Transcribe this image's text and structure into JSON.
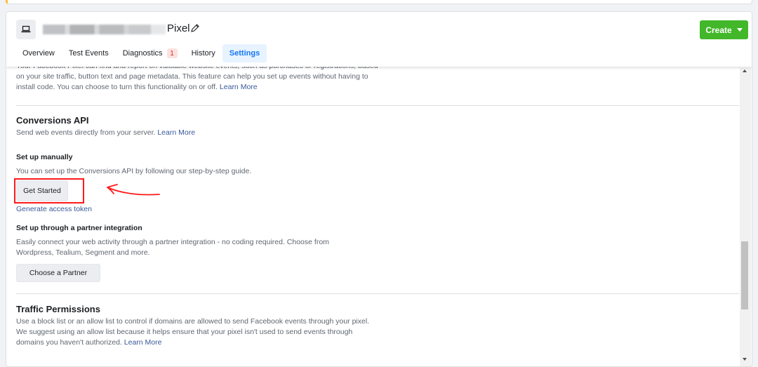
{
  "header": {
    "pixel_name": "Pixel",
    "create_label": "Create",
    "accent_color": "#42b72a"
  },
  "tabs": [
    {
      "label": "Overview"
    },
    {
      "label": "Test Events"
    },
    {
      "label": "Diagnostics",
      "badge": "1"
    },
    {
      "label": "History"
    },
    {
      "label": "Settings",
      "active": true
    }
  ],
  "intro": {
    "text": "Your Facebook Pixel can find and report on valuable website events, such as purchases or registrations, based on your site traffic, button text and page metadata. This feature can help you set up events without having to install code. You can choose to turn this functionality on or off.",
    "link": "Learn More"
  },
  "conversions_api": {
    "title": "Conversions API",
    "description": "Send web events directly from your server.",
    "link": "Learn More",
    "manual": {
      "title": "Set up manually",
      "description": "You can set up the Conversions API by following our step-by-step guide.",
      "button": "Get Started",
      "token_link": "Generate access token"
    },
    "partner": {
      "title": "Set up through a partner integration",
      "description": "Easily connect your web activity through a partner integration - no coding required. Choose from Wordpress, Tealium, Segment and more.",
      "button": "Choose a Partner"
    }
  },
  "traffic_permissions": {
    "title": "Traffic Permissions",
    "description": "Use a block list or an allow list to control if domains are allowed to send Facebook events through your pixel. We suggest using an allow list because it helps ensure that your pixel isn't used to send events through domains you haven't authorized.",
    "link": "Learn More"
  },
  "annotation": {
    "highlight_color": "#ff1a1a"
  }
}
